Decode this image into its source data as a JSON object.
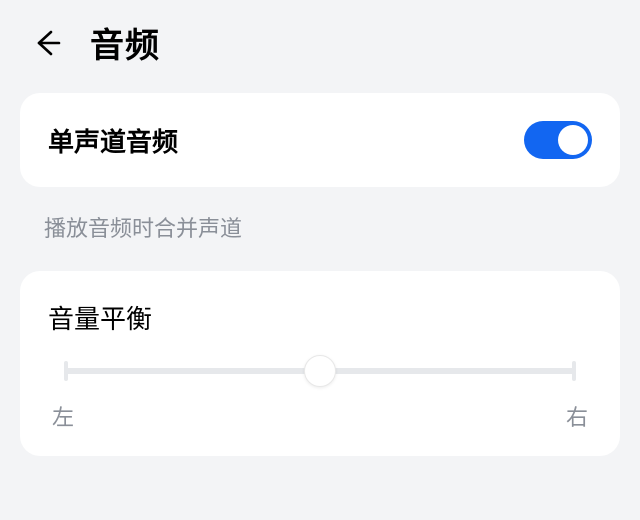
{
  "header": {
    "title": "音频"
  },
  "mono": {
    "label": "单声道音频",
    "enabled": true,
    "desc": "播放音频时合并声道"
  },
  "balance": {
    "title": "音量平衡",
    "value": 50,
    "left_label": "左",
    "right_label": "右"
  }
}
